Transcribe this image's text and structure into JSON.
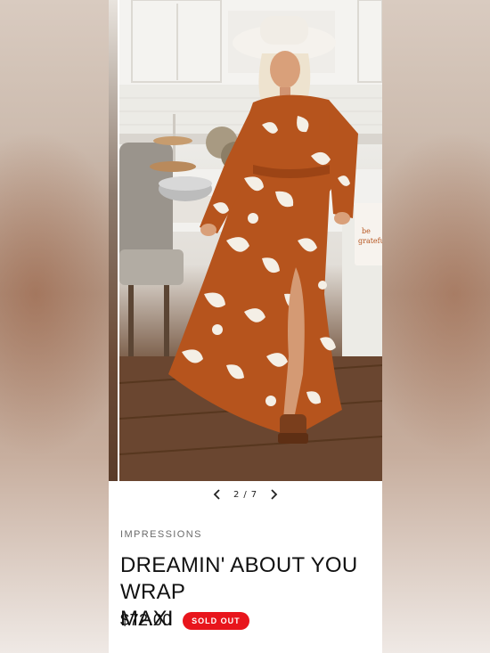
{
  "gallery": {
    "image_alt": "Model wearing rust floral print long sleeve maxi dress in a kitchen",
    "current": "2",
    "separator": "/",
    "total": "7",
    "prev_icon": "chevron-left-icon",
    "next_icon": "chevron-right-icon"
  },
  "product": {
    "brand": "IMPRESSIONS",
    "title": "DREAMIN' ABOUT YOU WRAP\nMAXI",
    "price": "$72.00",
    "status_badge": "SOLD OUT"
  },
  "colors": {
    "badge_red": "#e8151c",
    "dress_rust": "#b6541d",
    "text": "#111111"
  }
}
